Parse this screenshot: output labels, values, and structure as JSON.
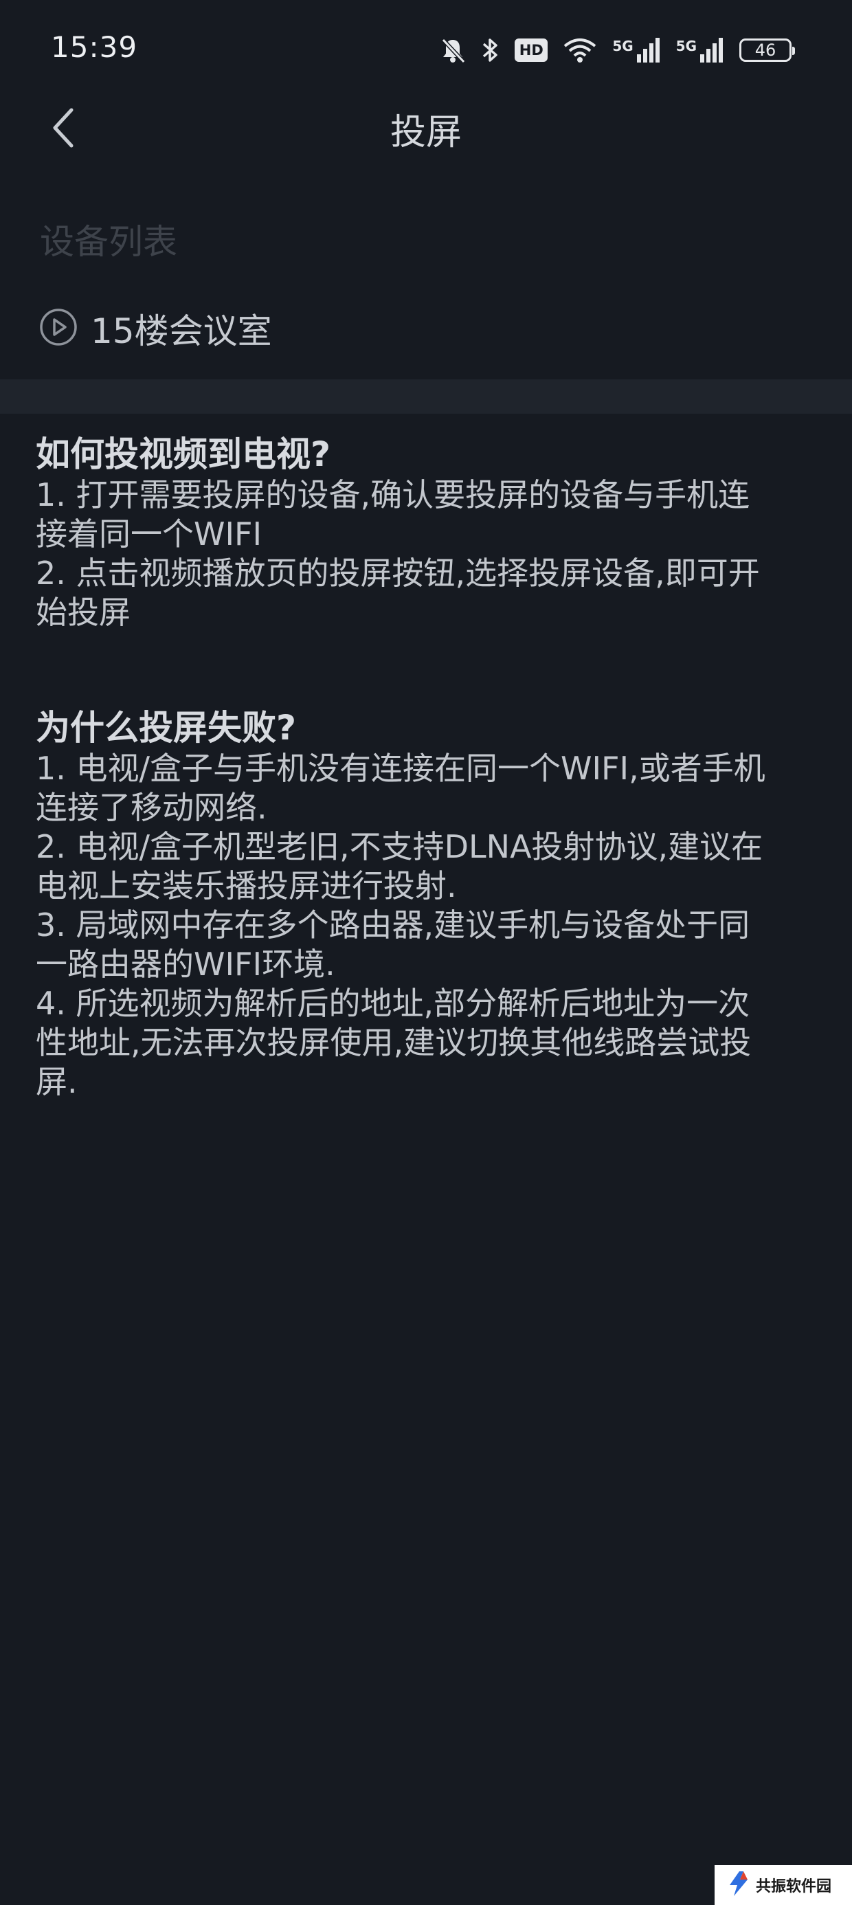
{
  "status_bar": {
    "time": "15:39",
    "hd_label": "HD",
    "network_label_1": "5G",
    "network_label_2": "5G",
    "battery": "46",
    "icons": [
      "bell-off-icon",
      "bluetooth-icon",
      "hd-icon",
      "wifi-icon",
      "signal-5g-icon",
      "signal-5g-icon",
      "battery-icon"
    ]
  },
  "nav": {
    "title": "投屏",
    "back_icon": "chevron-left-icon"
  },
  "device_list": {
    "label": "设备列表",
    "items": [
      {
        "name": "15楼会议室",
        "icon": "play-circle-icon"
      }
    ]
  },
  "help": [
    {
      "heading": "如何投视频到电视?",
      "lines": [
        "1. 打开需要投屏的设备,确认要投屏的设备与手机连",
        "接着同一个WIFI",
        "2. 点击视频播放页的投屏按钮,选择投屏设备,即可开",
        "始投屏"
      ]
    },
    {
      "heading": "为什么投屏失败?",
      "lines": [
        "1. 电视/盒子与手机没有连接在同一个WIFI,或者手机",
        "连接了移动网络.",
        "2. 电视/盒子机型老旧,不支持DLNA投射协议,建议在",
        "电视上安装乐播投屏进行投射.",
        "3. 局域网中存在多个路由器,建议手机与设备处于同",
        "一路由器的WIFI环境.",
        "4. 所选视频为解析后的地址,部分解析后地址为一次",
        "性地址,无法再次投屏使用,建议切换其他线路尝试投",
        "屏."
      ]
    }
  ],
  "watermark": {
    "text": "共振软件园"
  },
  "colors": {
    "background": "#161a21",
    "divider": "#1f242c",
    "text": "#c3c7cd",
    "muted_label": "#3e434b"
  }
}
